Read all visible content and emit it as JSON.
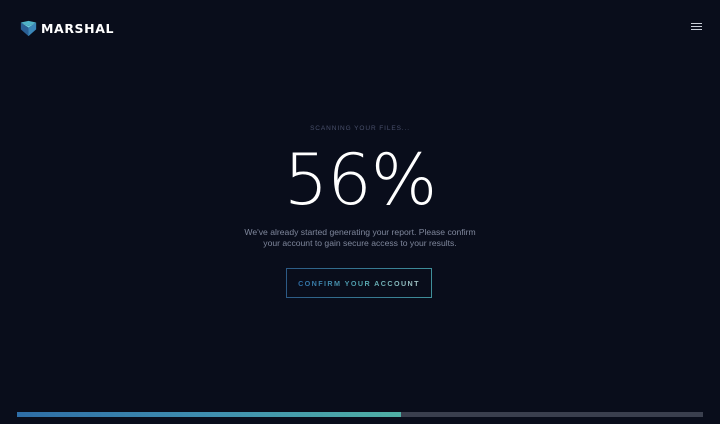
{
  "brand": {
    "name": "MARSHAL",
    "logo_icon": "marshal-shield-logo",
    "logo_colors": [
      "#6ecfe0",
      "#3a86b8",
      "#2a5f95"
    ]
  },
  "header": {
    "menu_icon": "hamburger-menu-icon"
  },
  "scan": {
    "status_label": "SCANNING YOUR FILES...",
    "percent_text": "56%",
    "progress": 0.56,
    "description_line1": "We've already started generating your report. Please confirm",
    "description_line2": "your account to gain secure access to your results."
  },
  "cta": {
    "label": "CONFIRM YOUR ACCOUNT"
  },
  "colors": {
    "background": "#090d1b",
    "progress_track": "#3a3f4e",
    "progress_start": "#2e6ea8",
    "progress_end": "#4fb0a6"
  }
}
